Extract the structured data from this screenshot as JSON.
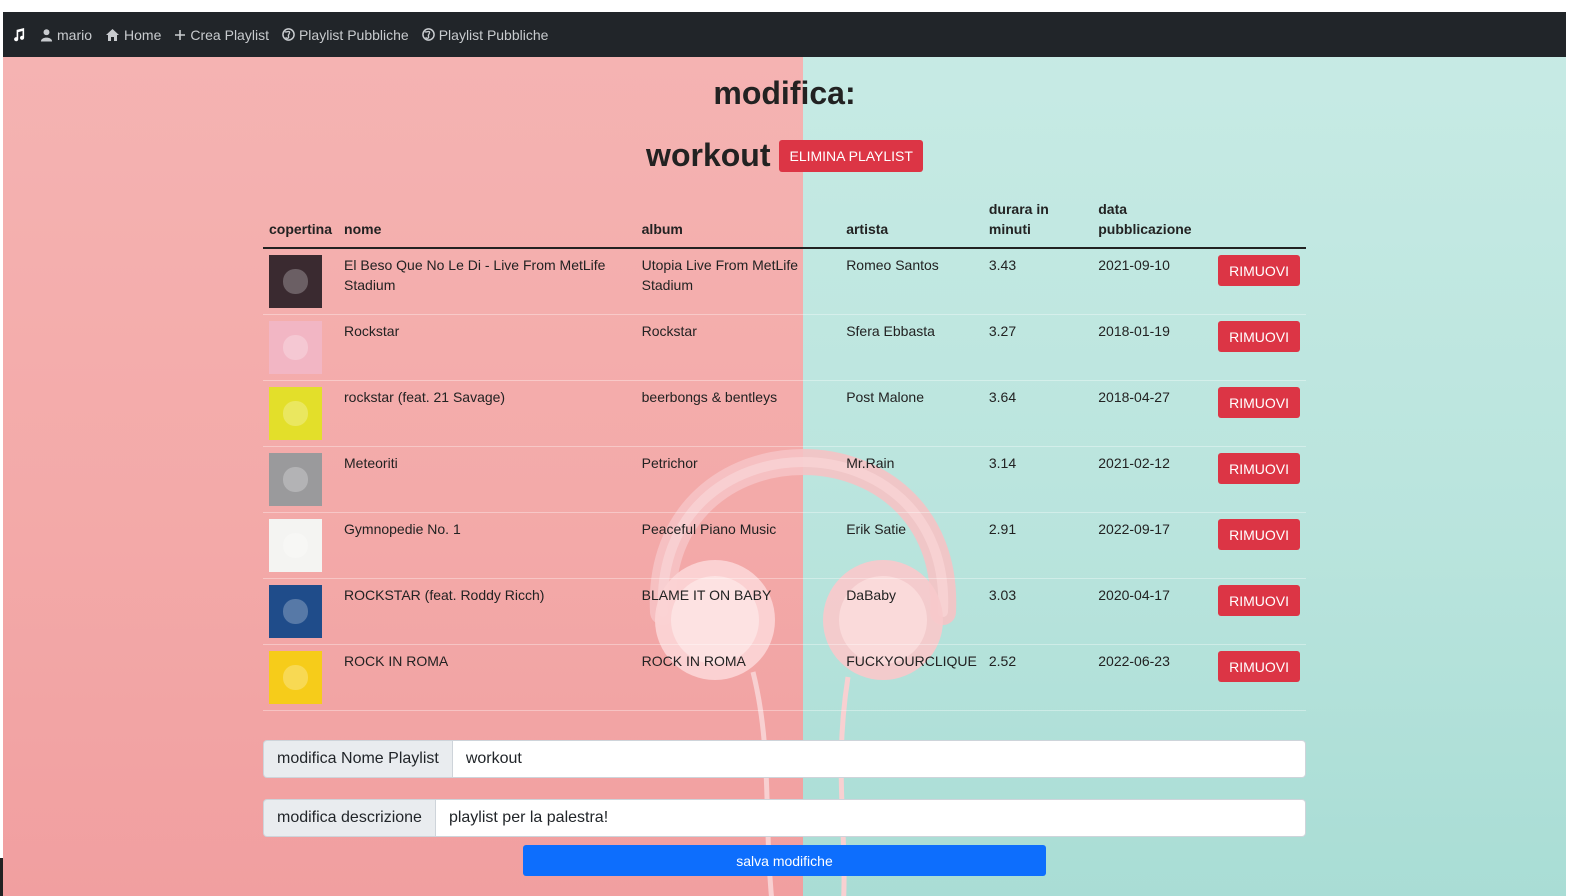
{
  "nav": {
    "user": "mario",
    "home": "Home",
    "create": "Crea Playlist",
    "public1": "Playlist Pubbliche",
    "public2": "Playlist Pubbliche"
  },
  "page": {
    "heading": "modifica:",
    "playlist_name": "workout",
    "delete_label": "ELIMINA PLAYLIST"
  },
  "table": {
    "headers": [
      "copertina",
      "nome",
      "album",
      "artista",
      "durara in minuti",
      "data pubblicazione"
    ],
    "remove_label": "RIMUOVI",
    "rows": [
      {
        "nome": "El Beso Que No Le Di - Live From MetLife Stadium",
        "album": "Utopia Live From MetLife Stadium",
        "artista": "Romeo Santos",
        "durata": "3.43",
        "data": "2021-09-10",
        "cover_color": "#3a2a30"
      },
      {
        "nome": "Rockstar",
        "album": "Rockstar",
        "artista": "Sfera Ebbasta",
        "durata": "3.27",
        "data": "2018-01-19",
        "cover_color": "#f2b6c4"
      },
      {
        "nome": "rockstar (feat. 21 Savage)",
        "album": "beerbongs & bentleys",
        "artista": "Post Malone",
        "durata": "3.64",
        "data": "2018-04-27",
        "cover_color": "#e3df2a"
      },
      {
        "nome": "Meteoriti",
        "album": "Petrichor",
        "artista": "Mr.Rain",
        "durata": "3.14",
        "data": "2021-02-12",
        "cover_color": "#9a9a9c"
      },
      {
        "nome": "Gymnopedie No. 1",
        "album": "Peaceful Piano Music",
        "artista": "Erik Satie",
        "durata": "2.91",
        "data": "2022-09-17",
        "cover_color": "#f4f4f2"
      },
      {
        "nome": "ROCKSTAR (feat. Roddy Ricch)",
        "album": "BLAME IT ON BABY",
        "artista": "DaBaby",
        "durata": "3.03",
        "data": "2020-04-17",
        "cover_color": "#1f4c8a"
      },
      {
        "nome": "ROCK IN ROMA",
        "album": "ROCK IN ROMA",
        "artista": "FUCKYOURCLIQUE",
        "durata": "2.52",
        "data": "2022-06-23",
        "cover_color": "#f6cc1a"
      }
    ]
  },
  "form": {
    "name_label": "modifica Nome Playlist",
    "name_value": "workout",
    "desc_label": "modifica descrizione",
    "desc_value": "playlist per la palestra!",
    "save_label": "salva modifiche"
  },
  "colors": {
    "navbar": "#212529",
    "danger": "#dc3545",
    "primary": "#0d6efd"
  }
}
